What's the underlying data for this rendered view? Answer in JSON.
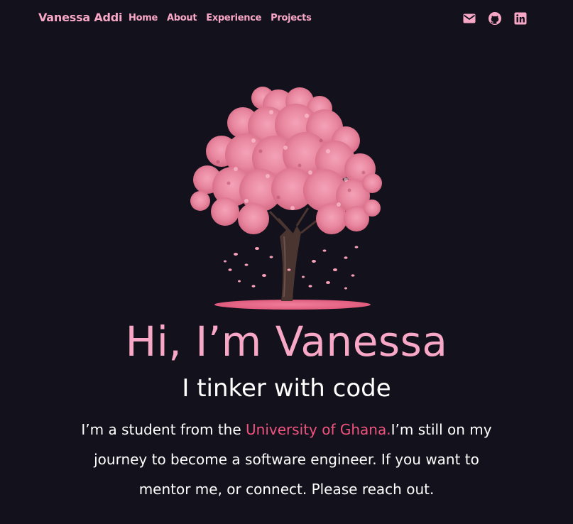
{
  "header": {
    "brand": "Vanessa Addi",
    "nav_links": [
      "Home",
      "About",
      "Experience",
      "Projects"
    ],
    "social_icons": [
      "mail-icon",
      "github-icon",
      "linkedin-icon"
    ]
  },
  "hero": {
    "image": "cherry-blossom-tree",
    "greeting": "Hi, I’m Vanessa",
    "tagline": "I tinker with code",
    "bio_before": "I’m a student from the ",
    "bio_highlight": "University of Ghana.",
    "bio_after": "I’m still on my journey to become a software engineer. If you want to mentor me, or connect. Please reach out."
  },
  "colors": {
    "background": "#13111c",
    "accent_pink": "#f8a8c6",
    "highlight_pink": "#f0537e",
    "text": "#ffffff"
  }
}
